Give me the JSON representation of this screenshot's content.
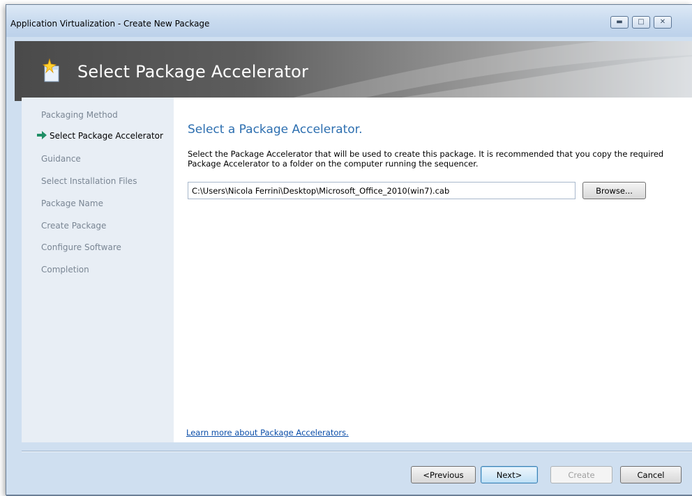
{
  "window": {
    "title": "Application Virtualization - Create New Package",
    "controls": {
      "minimize_icon": "minimize-icon",
      "maximize_icon": "maximize-icon",
      "close_icon": "close-icon"
    }
  },
  "header": {
    "title": "Select Package Accelerator",
    "icon": "wizard-sparkle-box-icon"
  },
  "sidebar": {
    "current_marker_icon": "green-arrow-icon",
    "steps": [
      {
        "label": "Packaging Method"
      },
      {
        "label": "Select Package Accelerator",
        "current": true
      },
      {
        "label": "Guidance"
      },
      {
        "label": "Select Installation Files"
      },
      {
        "label": "Package Name"
      },
      {
        "label": "Create Package"
      },
      {
        "label": "Configure Software"
      },
      {
        "label": "Completion"
      }
    ]
  },
  "main": {
    "heading": "Select a Package Accelerator.",
    "description": "Select the Package Accelerator that will be used to create this package. It is recommended that you copy the required Package Accelerator to a folder on the computer running the sequencer.",
    "path_value": "C:\\Users\\Nicola Ferrini\\Desktop\\Microsoft_Office_2010(win7).cab",
    "browse_label": "Browse...",
    "learn_more": "Learn more about Package Accelerators."
  },
  "footer": {
    "previous_label": "<Previous",
    "next_label": "Next>",
    "create_label": "Create",
    "cancel_label": "Cancel"
  },
  "colors": {
    "heading": "#2d6fb0",
    "link": "#0a4da8",
    "sidebar_bg": "#e8eef5",
    "disabled_step": "#7a8694",
    "arrow": "#1f8f66"
  }
}
